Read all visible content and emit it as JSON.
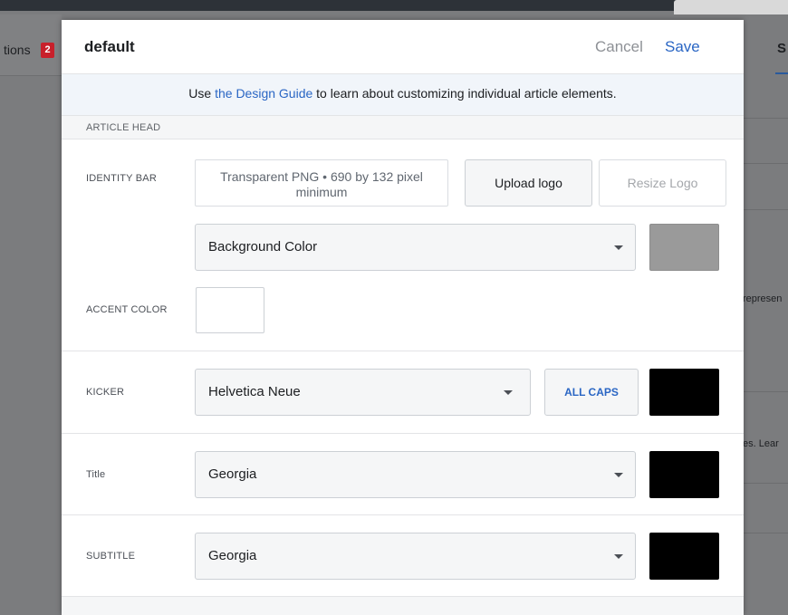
{
  "background_page": {
    "left_tab_label": "tions",
    "left_tab_badge": "2",
    "right_tab_label": "S",
    "right_snippet_1": "represen",
    "right_snippet_2": "es. Lear"
  },
  "modal": {
    "title": "default",
    "cancel_label": "Cancel",
    "save_label": "Save"
  },
  "info_banner": {
    "prefix": "Use ",
    "link_text": "the Design Guide",
    "suffix": " to learn about customizing individual article elements."
  },
  "sections": {
    "article_head": "ARTICLE HEAD"
  },
  "identity_bar": {
    "label": "IDENTITY BAR",
    "logo_hint": "Transparent PNG • 690 by 132 pixel minimum",
    "upload_label": "Upload logo",
    "resize_label": "Resize Logo",
    "background_select": "Background Color",
    "background_swatch_color": "#9a9a9a"
  },
  "accent_color": {
    "label": "ACCENT COLOR",
    "swatch_color": "#ffffff"
  },
  "kicker": {
    "label": "KICKER",
    "font": "Helvetica Neue",
    "allcaps_label": "ALL CAPS",
    "swatch_color": "#000000"
  },
  "title_row": {
    "label": "Title",
    "font": "Georgia",
    "swatch_color": "#000000"
  },
  "subtitle_row": {
    "label": "SUBTITLE",
    "font": "Georgia",
    "swatch_color": "#000000"
  }
}
